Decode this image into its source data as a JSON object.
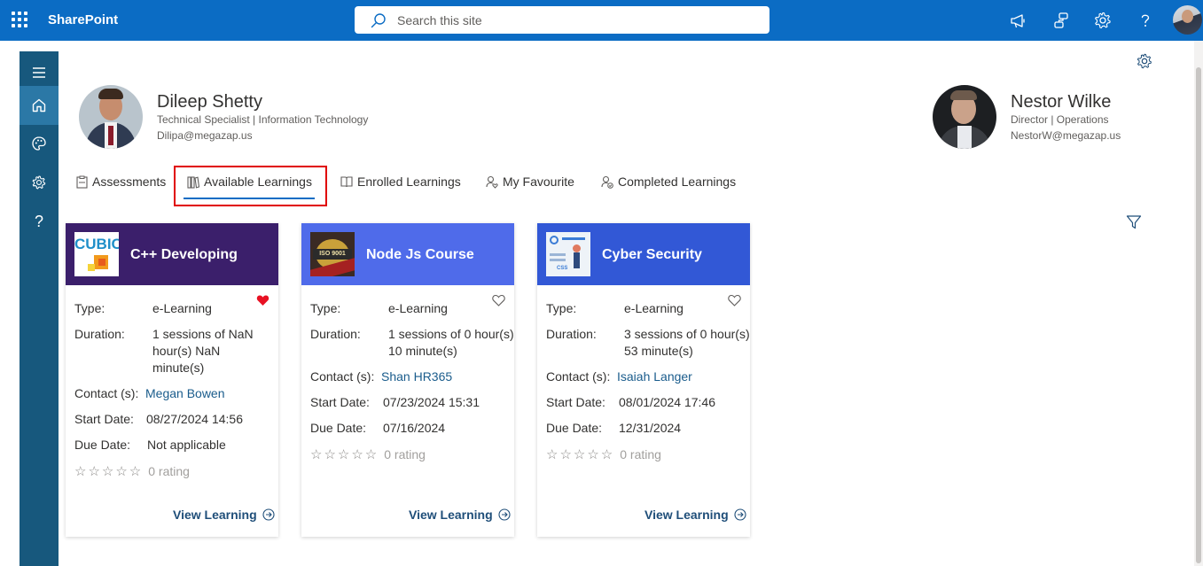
{
  "suitebar": {
    "brand": "SharePoint",
    "search_placeholder": "Search this site",
    "icons": [
      "megaphone-icon",
      "share-icon",
      "gear-icon",
      "help-icon",
      "user-avatar"
    ]
  },
  "leftnav": {
    "items": [
      "menu-icon",
      "home-icon",
      "palette-icon",
      "gear-icon",
      "help-icon"
    ],
    "help_glyph": "?"
  },
  "profiles": {
    "current": {
      "name": "Dileep Shetty",
      "title": "Technical Specialist | Information Technology",
      "email": "Dilipa@megazap.us"
    },
    "manager": {
      "name": "Nestor Wilke",
      "title": "Director | Operations",
      "email": "NestorW@megazap.us"
    }
  },
  "tabs": [
    {
      "label": "Assessments",
      "icon": "clipboard-icon"
    },
    {
      "label": "Available Learnings",
      "icon": "books-icon",
      "selected": true
    },
    {
      "label": "Enrolled Learnings",
      "icon": "book-icon"
    },
    {
      "label": "My Favourite",
      "icon": "person-heart-icon"
    },
    {
      "label": "Completed Learnings",
      "icon": "person-check-icon"
    }
  ],
  "labels": {
    "type": "Type:",
    "duration": "Duration:",
    "contact": "Contact (s):",
    "start_date": "Start Date:",
    "due_date": "Due Date:",
    "view": "View Learning",
    "rating_stars": "☆☆☆☆☆"
  },
  "courses": [
    {
      "title": "C++ Developing",
      "header_color": "#3b1f6b",
      "thumb_text": "CUBIC",
      "type": "e-Learning",
      "duration_lines": [
        "1 sessions of NaN",
        "hour(s) NaN",
        "minute(s)"
      ],
      "contact": "Megan Bowen",
      "start_date": "08/27/2024 14:56",
      "due_date": "Not applicable",
      "rating": "0 rating",
      "favourite": true
    },
    {
      "title": "Node Js Course",
      "header_color": "#4f6bea",
      "thumb_text": "ISO 9001",
      "type": "e-Learning",
      "duration_lines": [
        "1 sessions of 0 hour(s)",
        "10 minute(s)"
      ],
      "contact": "Shan HR365",
      "start_date": "07/23/2024 15:31",
      "due_date": "07/16/2024",
      "rating": "0 rating",
      "favourite": false
    },
    {
      "title": "Cyber Security",
      "header_color": "#3258d6",
      "thumb_text": "CSS",
      "type": "e-Learning",
      "duration_lines": [
        "3 sessions of 0 hour(s)",
        "53 minute(s)"
      ],
      "contact": "Isaiah Langer",
      "start_date": "08/01/2024 17:46",
      "due_date": "12/31/2024",
      "rating": "0 rating",
      "favourite": false
    }
  ],
  "colors": {
    "suitebar": "#0b6cc4",
    "leftnav": "#17587d",
    "accent": "#0b6cc4",
    "favourite": "#e81123",
    "highlight": "#e00000"
  }
}
